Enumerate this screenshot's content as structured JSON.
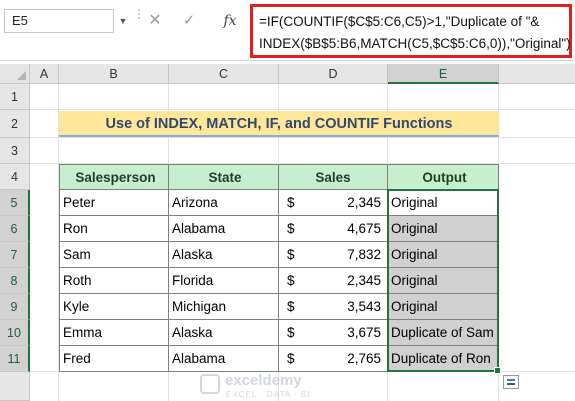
{
  "formula_bar": {
    "name_box": "E5",
    "cancel_glyph": "✕",
    "enter_glyph": "✓",
    "fx_label": "fx",
    "formula_line1": "=IF(COUNTIF($C$5:C6,C5)>1,\"Duplicate of \"&",
    "formula_line2": "INDEX($B$5:B6,MATCH(C5,$C$5:C6,0)),\"Original\")"
  },
  "columns": [
    "A",
    "B",
    "C",
    "D",
    "E"
  ],
  "rows": [
    "1",
    "2",
    "3",
    "4",
    "5",
    "6",
    "7",
    "8",
    "9",
    "10",
    "11"
  ],
  "selected_column": "E",
  "title": "Use of INDEX, MATCH, IF, and COUNTIF Functions",
  "table": {
    "headers": [
      "Salesperson",
      "State",
      "Sales",
      "Output"
    ],
    "rows": [
      {
        "name": "Peter",
        "state": "Arizona",
        "currency": "$",
        "sales": "2,345",
        "output": "Original"
      },
      {
        "name": "Ron",
        "state": "Alabama",
        "currency": "$",
        "sales": "4,675",
        "output": "Original"
      },
      {
        "name": "Sam",
        "state": "Alaska",
        "currency": "$",
        "sales": "7,832",
        "output": "Original"
      },
      {
        "name": "Roth",
        "state": "Florida",
        "currency": "$",
        "sales": "2,345",
        "output": "Original"
      },
      {
        "name": "Kyle",
        "state": "Michigan",
        "currency": "$",
        "sales": "3,543",
        "output": "Original"
      },
      {
        "name": "Emma",
        "state": "Alaska",
        "currency": "$",
        "sales": "3,675",
        "output": "Duplicate of Sam"
      },
      {
        "name": "Fred",
        "state": "Alabama",
        "currency": "$",
        "sales": "2,765",
        "output": "Duplicate of Ron"
      }
    ]
  },
  "watermark": {
    "name": "exceldemy",
    "tagline": "EXCEL · DATA · BI"
  },
  "colors": {
    "accent": "#217346",
    "title_fill": "#ffe699",
    "header_fill": "#c6efce",
    "highlight": "#e0201f"
  }
}
